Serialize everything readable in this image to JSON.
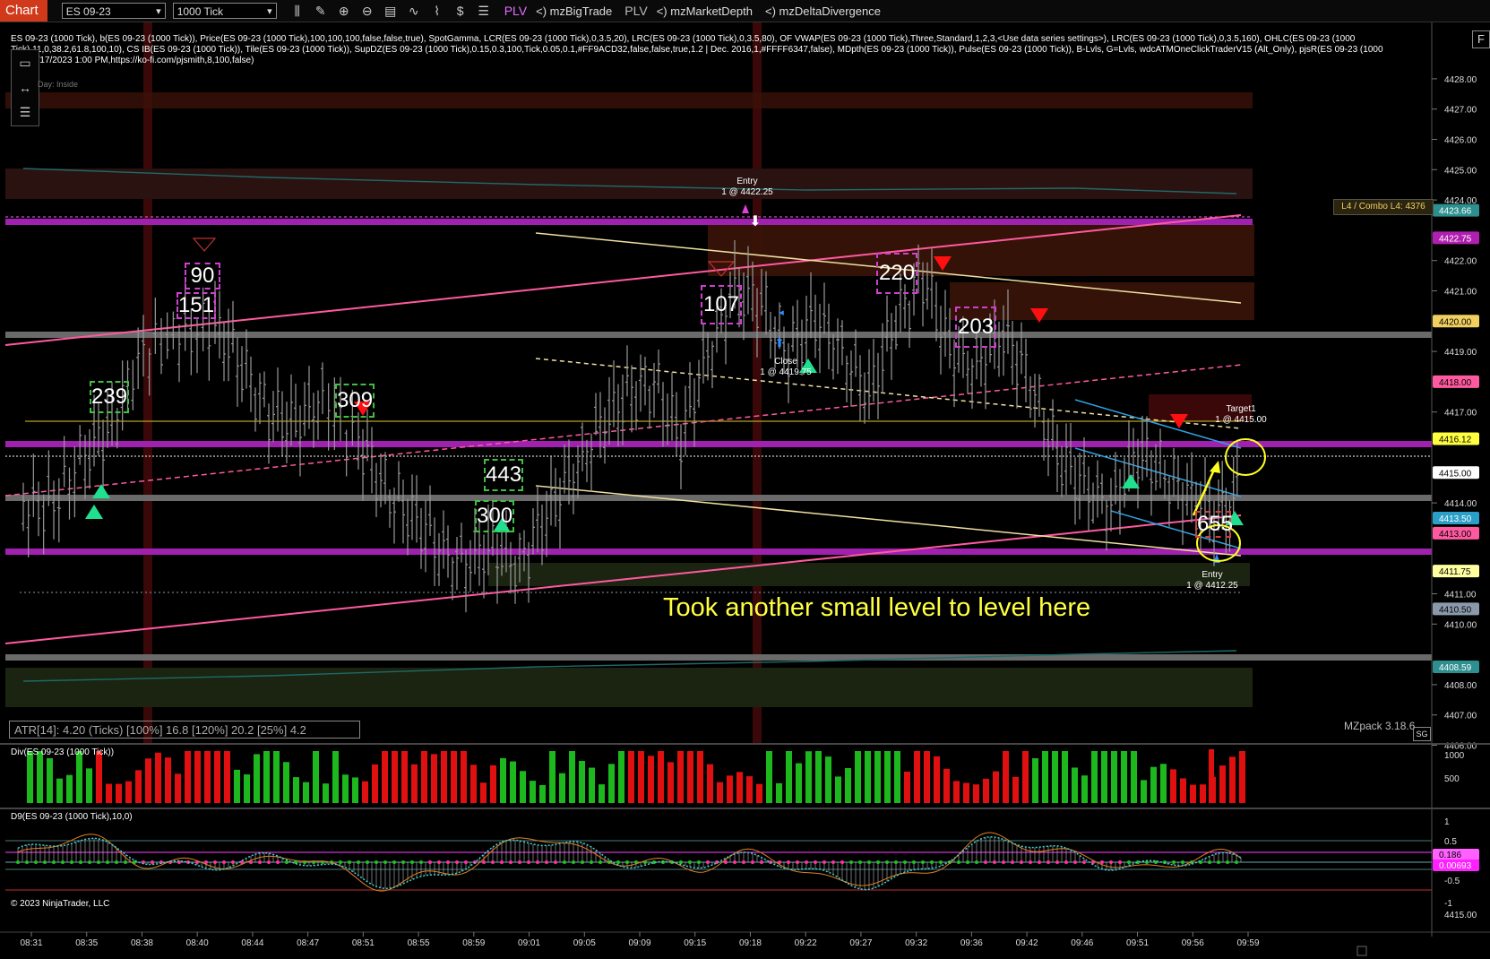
{
  "toolbar": {
    "chart_tab": "Chart",
    "instrument": "ES 09-23",
    "interval": "1000 Tick",
    "plv1": "PLV",
    "indicator1": "<) mzBigTrade",
    "plv2": "PLV",
    "indicator2": "<) mzMarketDepth",
    "indicator3": "<) mzDeltaDivergence",
    "icons": [
      "bars-icon",
      "pencil-icon",
      "zoom-in-icon",
      "zoom-out-icon",
      "properties-icon",
      "indicators-icon",
      "strategy-icon",
      "chart-trader-icon",
      "list-icon"
    ]
  },
  "info_line": "ES 09-23 (1000 Tick), b(ES 09-23 (1000 Tick)), Price(ES 09-23 (1000 Tick),100,100,100,false,false,true), SpotGamma, LCR(ES 09-23 (1000 Tick),0,3.5,20), LRC(ES 09-23 (1000 Tick),0,3.5,80), OF VWAP(ES 09-23 (1000 Tick),Three,Standard,1,2,3,<Use data series settings>), LRC(ES 09-23 (1000 Tick),0,3.5,160), OHLC(ES 09-23 (1000 Tick),11,0,38.2,61.8,100,10), CS IB(ES 09-23 (1000 Tick)), Tile(ES 09-23 (1000 Tick)), SupDZ(ES 09-23 (1000 Tick),0.15,0.3,100,Tick,0.05,0.1,#FF9ACD32,false,false,true,1.2 | Dec. 2016,1,#FFFF6347,false), MDpth(ES 09-23 (1000 Tick)), Pulse(ES 09-23 (1000 Tick)), B-Lvls, G=Lvls, wdcATMOneClickTraderV15 (Alt_Only), pjsR(ES 09-23 (1000 Tick),6/17/2023 1:00 PM,https://ko-fi.com/pjsmith,8,100,false)",
  "day_label": "Day: Inside",
  "atr_label": "ATR[14]: 4.20 (Ticks) [100%] 16.8  [120%] 20.2  [25%] 4.2",
  "mzpack_label": "MZpack 3.18.6",
  "sg_label": "SG",
  "combo_label": "L4 / Combo L4: 4376",
  "annotation": "Took another small level to level here",
  "div_title": "Div(ES 09-23 (1000 Tick))",
  "d9_title": "D9(ES 09-23 (1000 Tick),10,0)",
  "copyright": "© 2023 NinjaTrader, LLC",
  "corner_button": "F",
  "orders": {
    "entry1_label": "Entry",
    "entry1_value": "1 @ 4422.25",
    "close_label": "Close",
    "close_value": "1 @ 4419.75",
    "target_label": "Target1",
    "target_value": "1 @ 4415.00",
    "entry2_label": "Entry",
    "entry2_value": "1 @ 4412.25"
  },
  "footprint_numbers": [
    {
      "value": "90",
      "border": "#d040d0"
    },
    {
      "value": "151",
      "border": "#d040d0"
    },
    {
      "value": "239",
      "border": "#40c040"
    },
    {
      "value": "309",
      "border": "#40c040"
    },
    {
      "value": "443",
      "border": "#40c040"
    },
    {
      "value": "300",
      "border": "#40c040"
    },
    {
      "value": "107",
      "border": "#d040d0"
    },
    {
      "value": "220",
      "border": "#d040d0"
    },
    {
      "value": "203",
      "border": "#d040d0"
    },
    {
      "value": "655",
      "border": "#d04040"
    }
  ],
  "price_axis": {
    "ticks": [
      "4428.00",
      "4427.00",
      "4426.00",
      "4425.00",
      "4424.00",
      "4422.00",
      "4421.00",
      "4419.00",
      "4417.00",
      "4414.00",
      "4411.00",
      "4410.00",
      "4408.00",
      "4407.00",
      "4406.00"
    ],
    "markers": [
      {
        "label": "4423.66",
        "bg": "#2d8f8f",
        "color": "#fff"
      },
      {
        "label": "4422.75",
        "bg": "#b020b0",
        "color": "#fff"
      },
      {
        "label": "4420.00",
        "bg": "#f0d060",
        "color": "#000"
      },
      {
        "label": "4418.00",
        "bg": "#ff5aa0",
        "color": "#000"
      },
      {
        "label": "4416.12",
        "bg": "#ffff40",
        "color": "#000"
      },
      {
        "label": "4415.00",
        "bg": "#ffffff",
        "color": "#000"
      },
      {
        "label": "4413.50",
        "bg": "#2aa0c8",
        "color": "#fff"
      },
      {
        "label": "4413.00",
        "bg": "#ff5aa0",
        "color": "#000"
      },
      {
        "label": "4411.75",
        "bg": "#ffffa0",
        "color": "#000"
      },
      {
        "label": "4410.50",
        "bg": "#8a9aac",
        "color": "#000"
      },
      {
        "label": "4408.59",
        "bg": "#2d8f8f",
        "color": "#fff"
      }
    ]
  },
  "div_axis": [
    "1000",
    "500"
  ],
  "d9_axis": [
    "1",
    "0.5",
    "-0.5",
    "-1"
  ],
  "d9_markers": [
    {
      "label": "0.186",
      "bg": "#ff60ff",
      "color": "#000"
    },
    {
      "label": "0.00693",
      "bg": "#ff20ff",
      "color": "#fff"
    }
  ],
  "time_axis": [
    "08:31",
    "08:35",
    "08:38",
    "08:40",
    "08:44",
    "08:47",
    "08:51",
    "08:55",
    "08:59",
    "09:01",
    "09:05",
    "09:09",
    "09:15",
    "09:18",
    "09:22",
    "09:27",
    "09:32",
    "09:36",
    "09:42",
    "09:46",
    "09:51",
    "09:56",
    "09:59"
  ],
  "colors": {
    "magenta_level": "#a020b0",
    "gray_level": "#6a6a6a",
    "up_bar": "#1db81d",
    "down_bar": "#e01010",
    "annotation": "#ffff40"
  }
}
